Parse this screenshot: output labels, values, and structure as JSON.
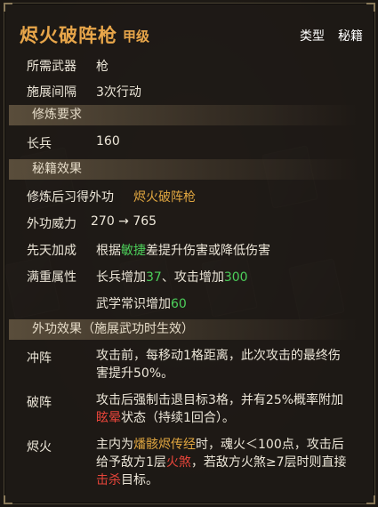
{
  "header": {
    "title": "烬火破阵枪",
    "grade": "甲级",
    "type_label": "类型",
    "type_value": "秘籍"
  },
  "basics": {
    "weapon_label": "所需武器",
    "weapon_value": "枪",
    "interval_label": "施展间隔",
    "interval_value": "3次行动"
  },
  "training": {
    "section_title": "修炼要求",
    "skill_label": "长兵",
    "skill_value": "160"
  },
  "manual": {
    "section_title": "秘籍效果",
    "learn_prefix": "修炼后习得外功",
    "learn_skill": "烬火破阵枪",
    "power_label": "外功威力",
    "power_value": "270 → 765",
    "bonus_label": "先天加成",
    "bonus_pre": "根据",
    "bonus_attr": "敏捷",
    "bonus_post": "差提升伤害或降低伤害",
    "full_label": "满重属性",
    "full_line1_a": "长兵增加",
    "full_line1_b": "37",
    "full_line1_c": "、攻击增加",
    "full_line1_d": "300",
    "full_line2_a": "武学常识增加",
    "full_line2_b": "60"
  },
  "effects": {
    "section_title": "外功效果（施展武功时生效）",
    "charge_label": "冲阵",
    "charge_text_1": "攻击前，每移动1格距离，此次攻击的最终伤",
    "charge_text_2": "害提升50%。",
    "break_label": "破阵",
    "break_text_1": "攻击后强制击退目标3格，并有25%概率附加",
    "break_stun": "眩晕",
    "break_text_2": "状态（持续1回合）。",
    "ember_label": "烬火",
    "ember_text_1a": "主内为",
    "ember_art": "燔骸烬传经",
    "ember_text_1b": "时，魂火＜100点，攻击后",
    "ember_text_2a": "给予敌方1层",
    "ember_fire": "火煞",
    "ember_text_2b": "，若敌方火煞≥7层时则直接",
    "ember_kill": "击杀",
    "ember_text_3": "目标。"
  },
  "colors": {
    "title": "#e8a64a",
    "highlight_gold": "#e0a640",
    "highlight_green": "#4ccf5a",
    "highlight_red": "#e8453a"
  }
}
